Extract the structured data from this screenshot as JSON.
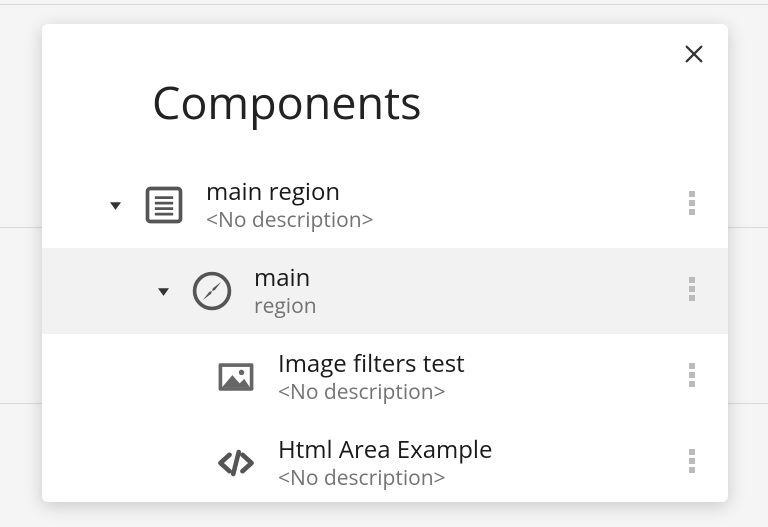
{
  "title": "Components",
  "nodes": [
    {
      "id": "main-region",
      "level": 0,
      "expandable": true,
      "icon": "document-icon",
      "label": "main region",
      "sublabel": "<No description>"
    },
    {
      "id": "main",
      "level": 1,
      "expandable": true,
      "icon": "compass-icon",
      "label": "main",
      "sublabel": "region",
      "selected": true
    },
    {
      "id": "image-filters-test",
      "level": 2,
      "expandable": false,
      "icon": "image-icon",
      "label": "Image filters test",
      "sublabel": "<No description>"
    },
    {
      "id": "html-area-example",
      "level": 2,
      "expandable": false,
      "icon": "code-icon",
      "label": "Html Area Example",
      "sublabel": "<No description>"
    }
  ]
}
